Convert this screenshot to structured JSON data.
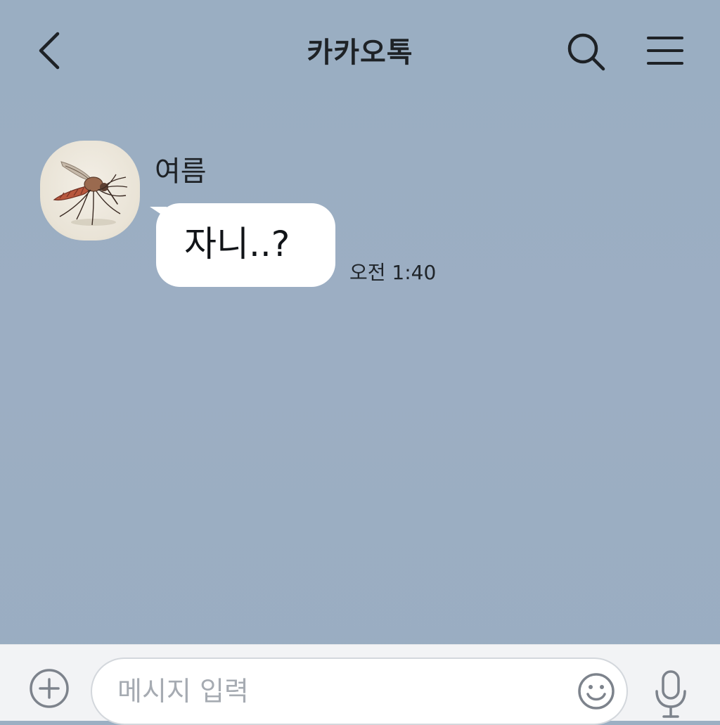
{
  "header": {
    "title": "카카오톡",
    "back_icon": "chevron-left-icon",
    "search_icon": "search-icon",
    "menu_icon": "hamburger-menu-icon"
  },
  "chat": {
    "messages": [
      {
        "sender": "여름",
        "avatar": "mosquito-avatar",
        "text": "자니..?",
        "time": "오전 1:40"
      }
    ]
  },
  "composer": {
    "placeholder": "메시지 입력",
    "value": "",
    "plus_icon": "plus-circle-icon",
    "emoji_icon": "smiley-icon",
    "mic_icon": "microphone-icon"
  },
  "colors": {
    "background": "#9bafc3",
    "bubble": "#ffffff",
    "input_bar": "#f2f3f5",
    "icon_dark": "#1e2226",
    "icon_gray": "#8a9099"
  }
}
